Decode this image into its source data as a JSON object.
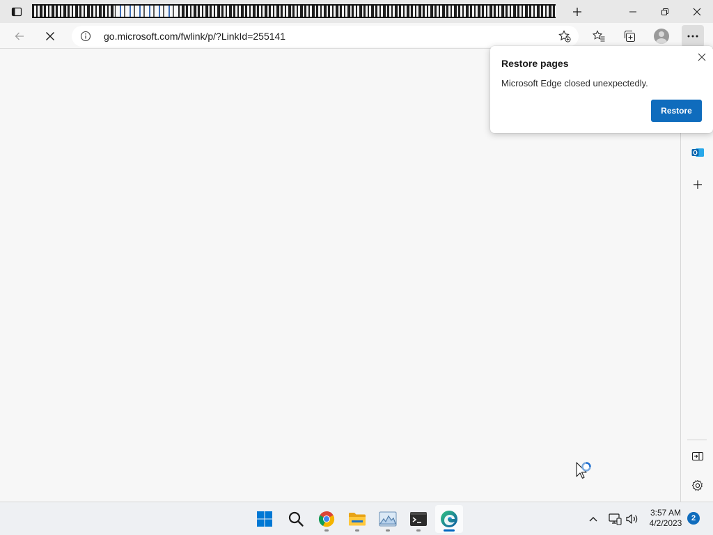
{
  "browser": {
    "address_bar": {
      "url": "go.microsoft.com/fwlink/p/?LinkId=255141"
    },
    "toolbar": {
      "back_icon": "arrow-left-icon",
      "stop_icon": "close-icon",
      "favorites_add_icon": "star-plus-icon",
      "favorites_icon": "favorites-icon",
      "collections_icon": "collections-icon",
      "profile_icon": "avatar-icon",
      "more_icon": "ellipsis-icon"
    },
    "sidebar": {
      "items": [
        "outlook-icon",
        "plus-icon",
        "split-screen-icon",
        "gear-icon"
      ]
    }
  },
  "restore_popup": {
    "title": "Restore pages",
    "message": "Microsoft Edge closed unexpectedly.",
    "button_label": "Restore",
    "accent_color": "#0f6cbd"
  },
  "taskbar": {
    "apps": [
      {
        "name": "start",
        "icon": "windows-logo-icon"
      },
      {
        "name": "search",
        "icon": "search-icon"
      },
      {
        "name": "chrome",
        "icon": "chrome-icon"
      },
      {
        "name": "file-explorer",
        "icon": "folder-icon"
      },
      {
        "name": "image-viewer",
        "icon": "image-icon"
      },
      {
        "name": "terminal",
        "icon": "terminal-icon"
      },
      {
        "name": "edge",
        "icon": "edge-icon",
        "active": true
      }
    ],
    "clock": {
      "time": "3:57 AM",
      "date": "4/2/2023"
    },
    "notification_count": "2"
  }
}
